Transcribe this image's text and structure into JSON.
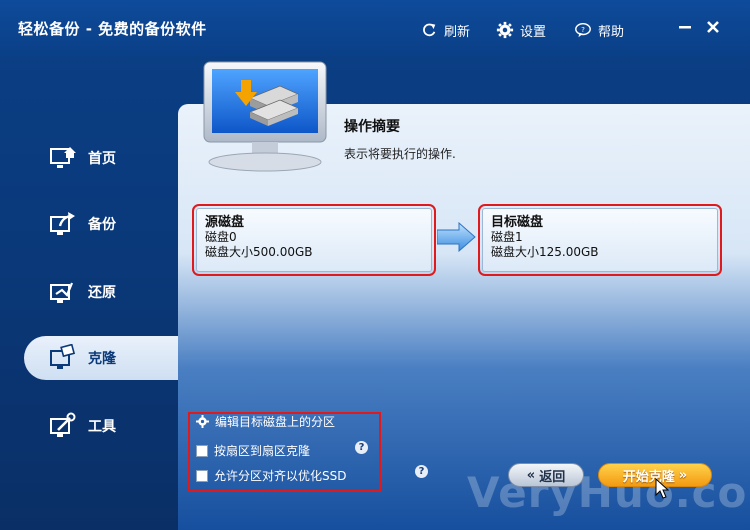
{
  "window": {
    "title": "轻松备份 - 免费的备份软件"
  },
  "toolbar": {
    "refresh": "刷新",
    "settings": "设置",
    "help": "帮助"
  },
  "sidebar": {
    "items": [
      {
        "label": "首页",
        "icon": "home-icon"
      },
      {
        "label": "备份",
        "icon": "backup-icon"
      },
      {
        "label": "还原",
        "icon": "restore-icon"
      },
      {
        "label": "克隆",
        "icon": "clone-icon",
        "active": true
      },
      {
        "label": "工具",
        "icon": "tools-icon"
      }
    ]
  },
  "summary": {
    "title": "操作摘要",
    "description": "表示将要执行的操作."
  },
  "source_disk": {
    "heading": "源磁盘",
    "name": "磁盘0",
    "size": "磁盘大小500.00GB"
  },
  "target_disk": {
    "heading": "目标磁盘",
    "name": "磁盘1",
    "size": "磁盘大小125.00GB"
  },
  "options": {
    "edit_partitions": "编辑目标磁盘上的分区",
    "sector_clone": "按扇区到扇区克隆",
    "align_ssd": "允许分区对齐以优化SSD",
    "help_mark": "?"
  },
  "buttons": {
    "back": "返回",
    "back_icon": "«",
    "start": "开始克隆",
    "start_icon": "»"
  },
  "watermark": "VeryHuo.com",
  "colors": {
    "accent": "#0b3f86",
    "highlight": "#e0191d",
    "start_button": "#f39a12"
  }
}
